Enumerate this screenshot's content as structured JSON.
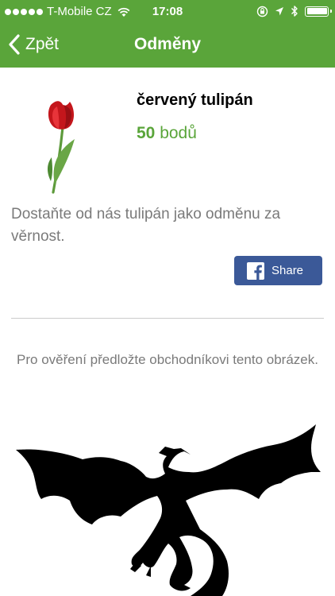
{
  "status_bar": {
    "carrier": "T-Mobile CZ",
    "time": "17:08",
    "signal_bars": 5,
    "battery_icon": "battery-full-icon"
  },
  "navbar": {
    "back_label": "Zpět",
    "title": "Odměny"
  },
  "reward": {
    "name": "červený tulipán",
    "points_value": "50",
    "points_unit": "bodů",
    "description": "Dostaňte od nás tulipán jako odměnu za věrnost.",
    "image_icon": "tulip-icon"
  },
  "share": {
    "label": "Share",
    "icon": "facebook-icon"
  },
  "verification": {
    "text": "Pro ověření předložte obchodníkovi tento obrázek.",
    "image_icon": "dragon-silhouette-icon"
  },
  "colors": {
    "accent": "#5aa53a",
    "facebook": "#3b5998",
    "muted_text": "#7a7a7a"
  }
}
